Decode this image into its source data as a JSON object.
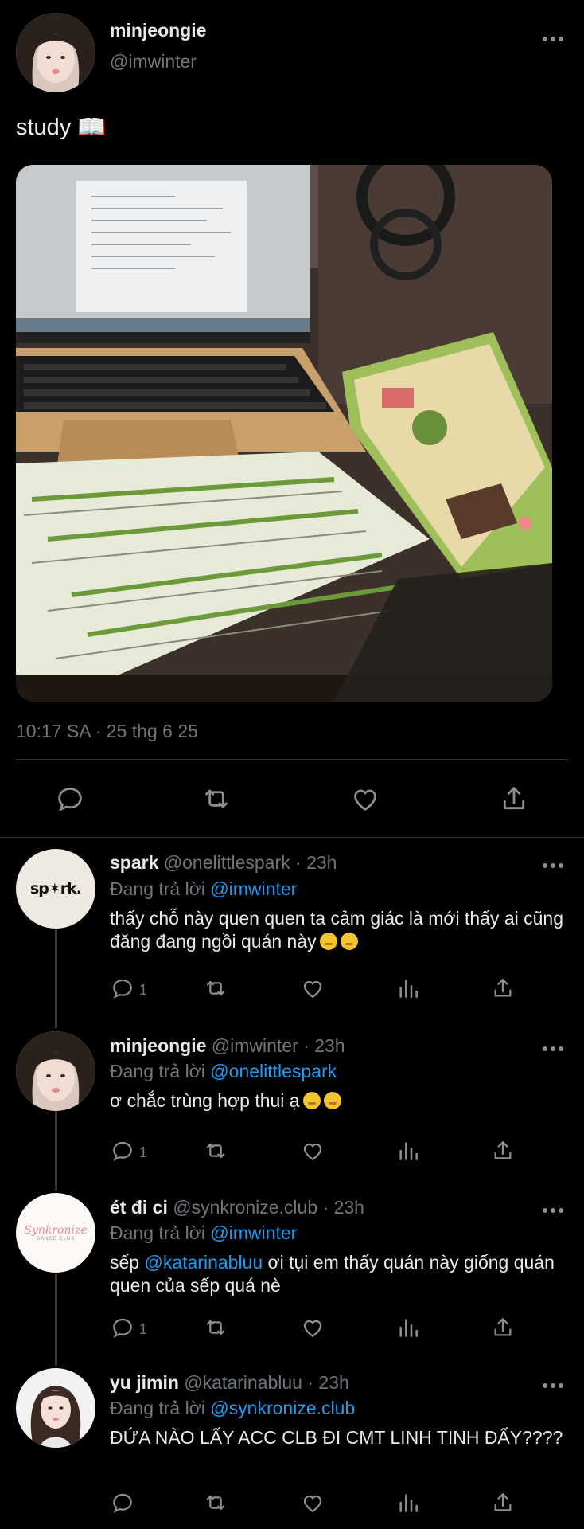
{
  "main_tweet": {
    "display_name": "minjeongie",
    "handle": "@imwinter",
    "text": "study 📖",
    "timestamp": "10:17 SA · 25 thg 6 25",
    "photo_icon": "photo-of-laptop-and-notebook"
  },
  "replies": [
    {
      "display_name": "spark",
      "handle": "@onelittlespark",
      "time": "· 23h",
      "replying_label": "Đang trả lời",
      "replying_to": "@imwinter",
      "text": "thấy chỗ này quen quen ta cảm giác là mới thấy ai cũng đăng đang ngồi quán này",
      "reply_count": "1",
      "avatar_text": "sp✶rk."
    },
    {
      "display_name": "minjeongie",
      "handle": "@imwinter",
      "time": "· 23h",
      "replying_label": "Đang trả lời",
      "replying_to": "@onelittlespark",
      "text": "ơ chắc trùng hợp thui ạ",
      "reply_count": "1"
    },
    {
      "display_name": "ét đi ci",
      "handle": "@synkronize.club",
      "time": "· 23h",
      "replying_label": "Đang trả lời",
      "replying_to": "@imwinter",
      "text_prefix": "sếp ",
      "mention": "@katarinabluu",
      "text_suffix": " ơi tụi em thấy quán này giống quán quen của sếp quá nè",
      "reply_count": "1",
      "avatar_text": "Synkronize",
      "avatar_subtext": "DANCE CLUB"
    },
    {
      "display_name": "yu jimin",
      "handle": "@katarinabluu",
      "time": "· 23h",
      "replying_label": "Đang trả lời",
      "replying_to": "@synkronize.club",
      "text": "ĐỨA NÀO LẤY ACC CLB ĐI CMT LINH TINH ĐẤY????"
    }
  ],
  "colors": {
    "background": "#000000",
    "text": "#e7e9ea",
    "muted": "#71767b",
    "link": "#1d9bf0",
    "divider": "#2f3336"
  }
}
